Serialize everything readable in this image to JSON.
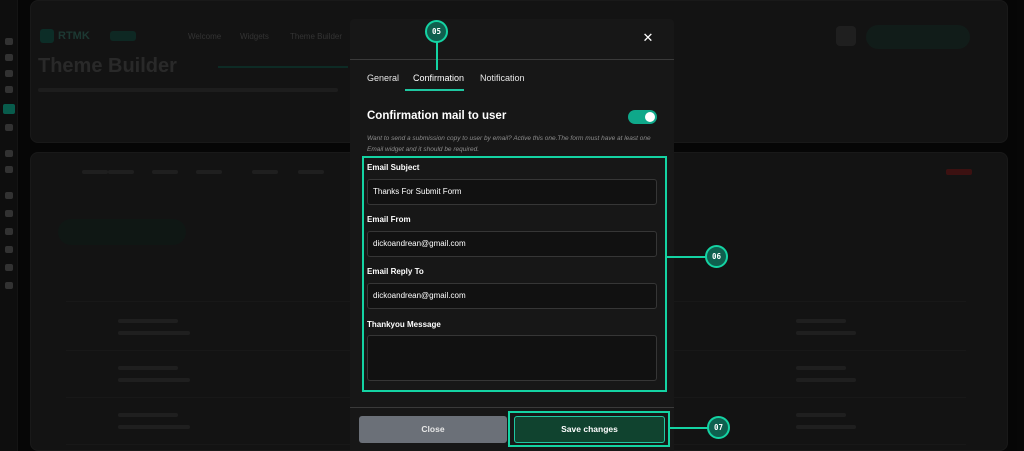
{
  "modal": {
    "close_glyph": "✕",
    "tabs": [
      {
        "label": "General",
        "active": false
      },
      {
        "label": "Confirmation",
        "active": true
      },
      {
        "label": "Notification",
        "active": false
      }
    ],
    "section": {
      "title": "Confirmation mail to user",
      "toggle_on": true,
      "description": "Want to send a submission copy to user by email? Active this one.The form must have at least one Email widget and it should be required."
    },
    "fields": {
      "email_subject": {
        "label": "Email Subject",
        "value": "Thanks For Submit Form"
      },
      "email_from": {
        "label": "Email From",
        "value": "dickoandrean@gmail.com"
      },
      "email_reply_to": {
        "label": "Email Reply To",
        "value": "dickoandrean@gmail.com"
      },
      "thankyou_message": {
        "label": "Thankyou Message",
        "value": ""
      }
    },
    "buttons": {
      "close_label": "Close",
      "save_label": "Save changes"
    }
  },
  "annotations": {
    "tabs_badge": "05",
    "fields_badge": "06",
    "save_badge": "07"
  },
  "background": {
    "brand": "RTMK",
    "title": "Theme Builder",
    "nav": [
      "Welcome",
      "Widgets",
      "Theme Builder"
    ]
  },
  "colors": {
    "accent": "#14d3a3",
    "toggle": "#0fa88a",
    "save_bg": "#10432f",
    "close_bg": "#6b7078",
    "modal_bg": "#171717"
  }
}
